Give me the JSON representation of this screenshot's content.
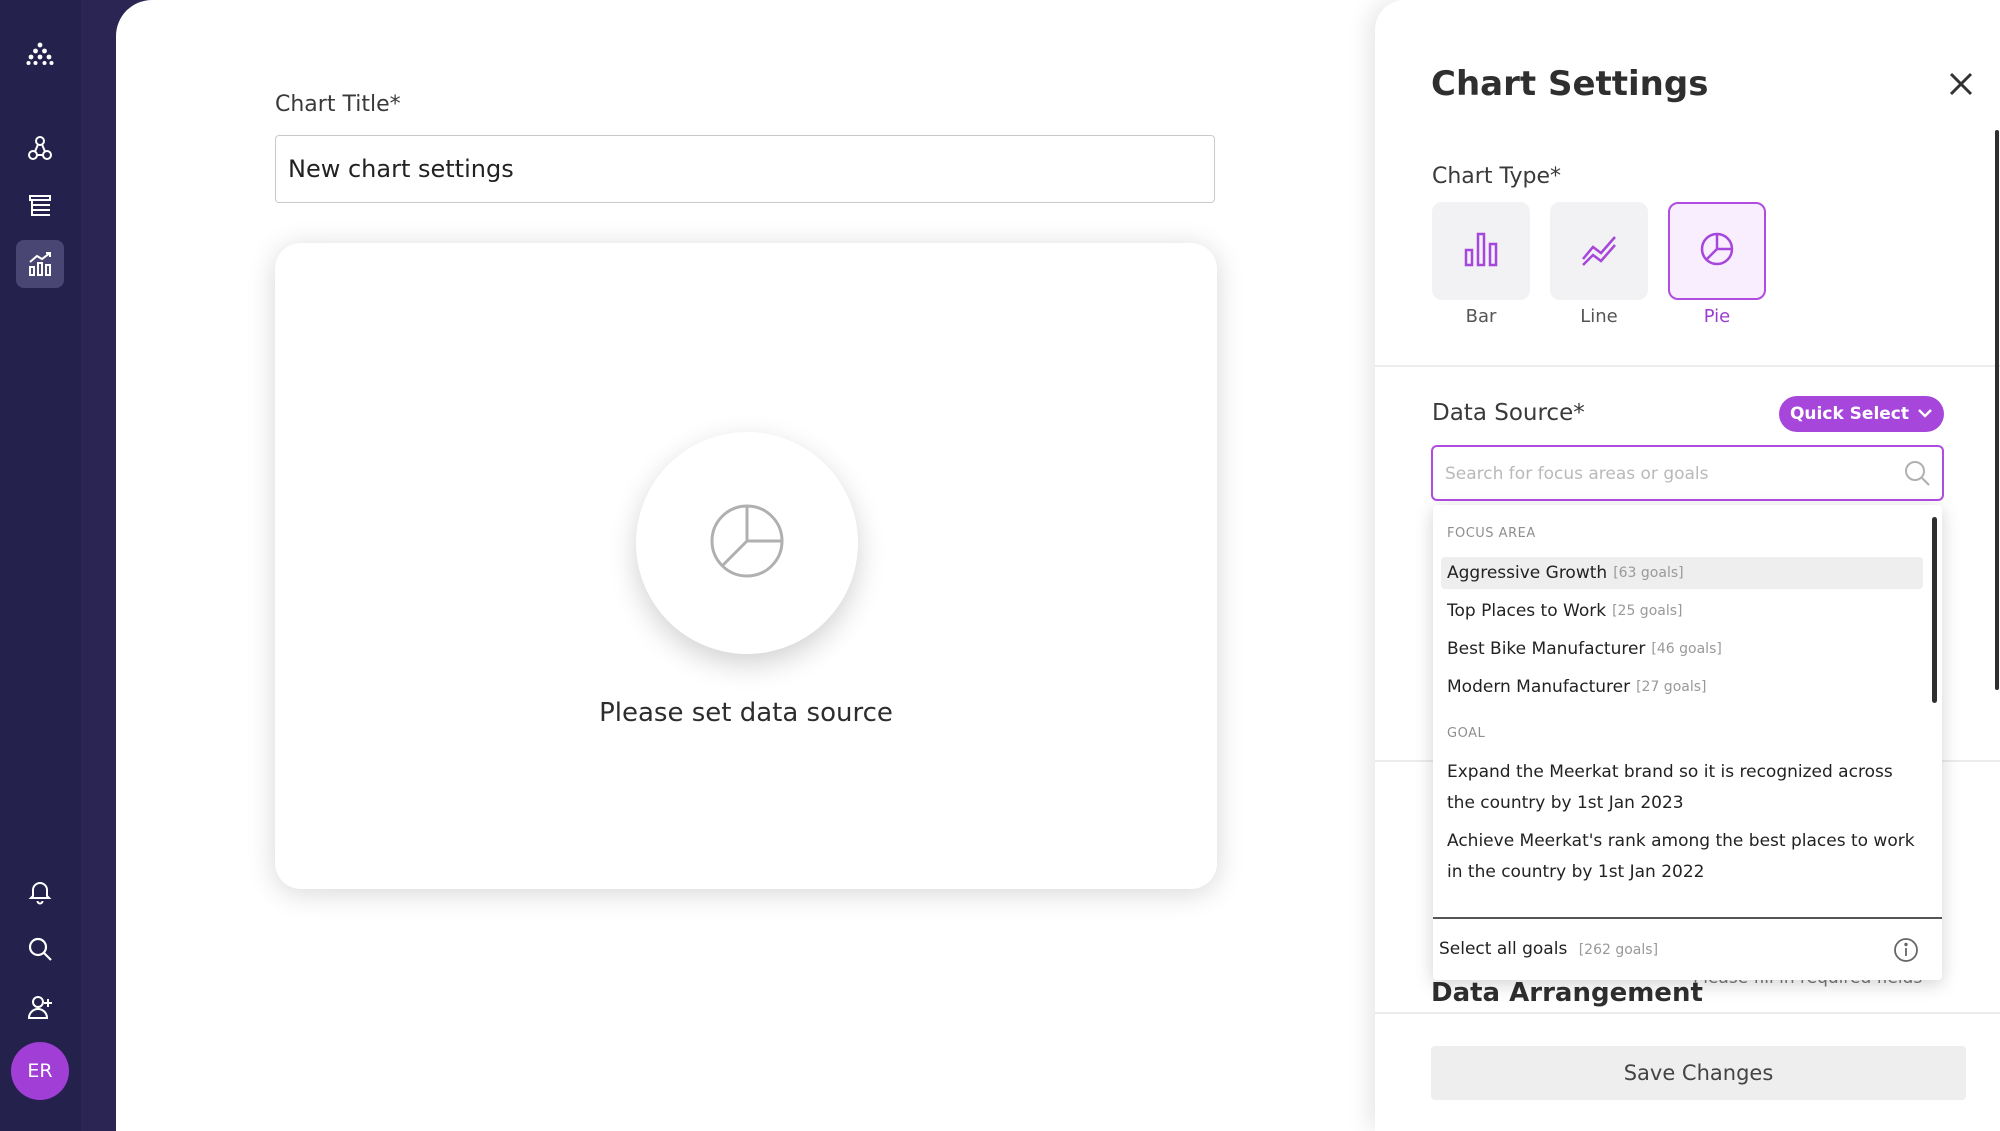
{
  "sidebar": {
    "icons": [
      "logo-icon",
      "network-icon",
      "list-tree-icon",
      "analytics-icon",
      "bell-icon",
      "search-icon",
      "add-user-icon"
    ],
    "active": "analytics-icon",
    "avatar_initials": "ER"
  },
  "editor": {
    "title_label": "Chart Title*",
    "title_value": "New chart settings",
    "preview_message": "Please set data source"
  },
  "settings": {
    "title": "Chart Settings",
    "chart_type_label": "Chart Type*",
    "chart_types": [
      {
        "label": "Bar",
        "icon": "bar-chart-icon",
        "selected": false
      },
      {
        "label": "Line",
        "icon": "line-chart-icon",
        "selected": false
      },
      {
        "label": "Pie",
        "icon": "pie-chart-icon",
        "selected": true
      }
    ],
    "data_source_label": "Data Source*",
    "quick_select_label": "Quick Select",
    "search_placeholder": "Search for focus areas or goals",
    "behind_section_title": "Data Arrangement",
    "behind_warning": "Please fill in required fields",
    "save_label": "Save Changes"
  },
  "dropdown": {
    "focus_area_header": "FOCUS AREA",
    "focus_areas": [
      {
        "name": "Aggressive Growth",
        "count": "[63 goals]"
      },
      {
        "name": "Top Places to Work",
        "count": "[25 goals]"
      },
      {
        "name": "Best Bike Manufacturer",
        "count": "[46 goals]"
      },
      {
        "name": "Modern Manufacturer",
        "count": "[27 goals]"
      }
    ],
    "goal_header": "GOAL",
    "goals": [
      "Expand the Meerkat brand so it is recognized across the country by 1st Jan 2023",
      "Achieve Meerkat's rank among the best places to work in the country by 1st Jan 2022"
    ],
    "select_all_label": "Select all goals",
    "select_all_count": "[262 goals]"
  },
  "colors": {
    "rail": "#25214d",
    "accent": "#a646db",
    "avatar": "#a03ed6"
  }
}
